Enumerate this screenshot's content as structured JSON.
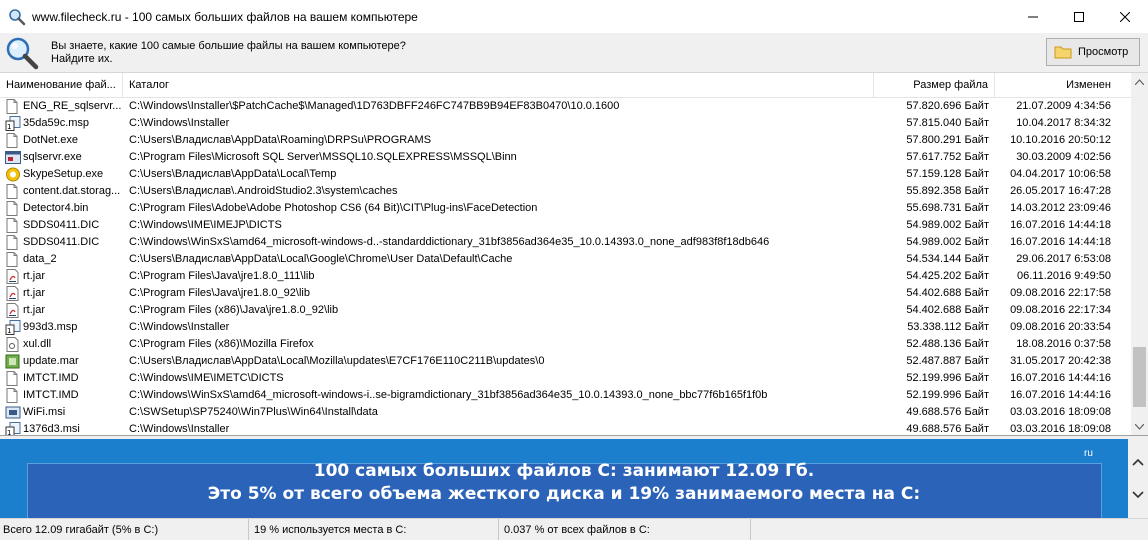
{
  "window": {
    "title": "www.filecheck.ru - 100 самых больших файлов на вашем компьютере",
    "icon": "magnifier-icon",
    "controls": [
      "minimize-icon",
      "maximize-icon",
      "close-icon"
    ]
  },
  "infobar": {
    "question": "Вы знаете, какие 100 самые большие файлы на вашем компьютере?",
    "answer": "Найдите их.",
    "view_button": "Просмотр"
  },
  "table": {
    "columns": {
      "name": "Наименование фай...",
      "dir": "Каталог",
      "size": "Размер файла",
      "modified": "Изменен"
    },
    "rows": [
      {
        "icon": "doc",
        "name": "ENG_RE_sqlservr...",
        "dir": "C:\\Windows\\Installer\\$PatchCache$\\Managed\\1D763DBFF246FC747BB9B94EF83B0470\\10.0.1600",
        "size": "57.820.696 Байт",
        "modified": "21.07.2009 4:34:56"
      },
      {
        "icon": "msp",
        "name": "35da59c.msp",
        "dir": "C:\\Windows\\Installer",
        "size": "57.815.040 Байт",
        "modified": "10.04.2017 8:34:32"
      },
      {
        "icon": "doc",
        "name": "DotNet.exe",
        "dir": "C:\\Users\\Владислав\\AppData\\Roaming\\DRPSu\\PROGRAMS",
        "size": "57.800.291 Байт",
        "modified": "10.10.2016 20:50:12"
      },
      {
        "icon": "exe",
        "name": "sqlservr.exe",
        "dir": "C:\\Program Files\\Microsoft SQL Server\\MSSQL10.SQLEXPRESS\\MSSQL\\Binn",
        "size": "57.617.752 Байт",
        "modified": "30.03.2009 4:02:56"
      },
      {
        "icon": "skype",
        "name": "SkypeSetup.exe",
        "dir": "C:\\Users\\Владислав\\AppData\\Local\\Temp",
        "size": "57.159.128 Байт",
        "modified": "04.04.2017 10:06:58"
      },
      {
        "icon": "doc",
        "name": "content.dat.storag...",
        "dir": "C:\\Users\\Владислав\\.AndroidStudio2.3\\system\\caches",
        "size": "55.892.358 Байт",
        "modified": "26.05.2017 16:47:28"
      },
      {
        "icon": "doc",
        "name": "Detector4.bin",
        "dir": "C:\\Program Files\\Adobe\\Adobe Photoshop CS6 (64 Bit)\\CIT\\Plug-ins\\FaceDetection",
        "size": "55.698.731 Байт",
        "modified": "14.03.2012 23:09:46"
      },
      {
        "icon": "doc",
        "name": "SDDS0411.DIC",
        "dir": "C:\\Windows\\IME\\IMEJP\\DICTS",
        "size": "54.989.002 Байт",
        "modified": "16.07.2016 14:44:18"
      },
      {
        "icon": "doc",
        "name": "SDDS0411.DIC",
        "dir": "C:\\Windows\\WinSxS\\amd64_microsoft-windows-d..-standarddictionary_31bf3856ad364e35_10.0.14393.0_none_adf983f8f18db646",
        "size": "54.989.002 Байт",
        "modified": "16.07.2016 14:44:18"
      },
      {
        "icon": "doc",
        "name": "data_2",
        "dir": "C:\\Users\\Владислав\\AppData\\Local\\Google\\Chrome\\User Data\\Default\\Cache",
        "size": "54.534.144 Байт",
        "modified": "29.06.2017 6:53:08"
      },
      {
        "icon": "jar",
        "name": "rt.jar",
        "dir": "C:\\Program Files\\Java\\jre1.8.0_111\\lib",
        "size": "54.425.202 Байт",
        "modified": "06.11.2016 9:49:50"
      },
      {
        "icon": "jar",
        "name": "rt.jar",
        "dir": "C:\\Program Files\\Java\\jre1.8.0_92\\lib",
        "size": "54.402.688 Байт",
        "modified": "09.08.2016 22:17:58"
      },
      {
        "icon": "jar",
        "name": "rt.jar",
        "dir": "C:\\Program Files (x86)\\Java\\jre1.8.0_92\\lib",
        "size": "54.402.688 Байт",
        "modified": "09.08.2016 22:17:34"
      },
      {
        "icon": "msp",
        "name": "993d3.msp",
        "dir": "C:\\Windows\\Installer",
        "size": "53.338.112 Байт",
        "modified": "09.08.2016 20:33:54"
      },
      {
        "icon": "dll",
        "name": "xul.dll",
        "dir": "C:\\Program Files (x86)\\Mozilla Firefox",
        "size": "52.488.136 Байт",
        "modified": "18.08.2016 0:37:58"
      },
      {
        "icon": "mar",
        "name": "update.mar",
        "dir": "C:\\Users\\Владислав\\AppData\\Local\\Mozilla\\updates\\E7CF176E110C211B\\updates\\0",
        "size": "52.487.887 Байт",
        "modified": "31.05.2017 20:42:38"
      },
      {
        "icon": "doc",
        "name": "IMTCT.IMD",
        "dir": "C:\\Windows\\IME\\IMETC\\DICTS",
        "size": "52.199.996 Байт",
        "modified": "16.07.2016 14:44:16"
      },
      {
        "icon": "doc",
        "name": "IMTCT.IMD",
        "dir": "C:\\Windows\\WinSxS\\amd64_microsoft-windows-i..se-bigramdictionary_31bf3856ad364e35_10.0.14393.0_none_bbc77f6b165f1f0b",
        "size": "52.199.996 Байт",
        "modified": "16.07.2016 14:44:16"
      },
      {
        "icon": "msi",
        "name": "WiFi.msi",
        "dir": "C:\\SWSetup\\SP75240\\Win7Plus\\Win64\\Install\\data",
        "size": "49.688.576 Байт",
        "modified": "03.03.2016 18:09:08"
      },
      {
        "icon": "msp",
        "name": "1376d3.msi",
        "dir": "C:\\Windows\\Installer",
        "size": "49.688.576 Байт",
        "modified": "03.03.2016 18:09:08"
      }
    ]
  },
  "banner": {
    "lang": "ru",
    "headline": "100 самых больших файлов С: занимают 12.09 Гб.",
    "sub": "Это 5% от всего объема жесткого диска и 19% занимаемого места на С:"
  },
  "status": {
    "total": "Всего 12.09 гигабайт (5% в C:)",
    "used": "19 % используется места в C:",
    "files": "0.037 % от всех файлов в C:"
  }
}
